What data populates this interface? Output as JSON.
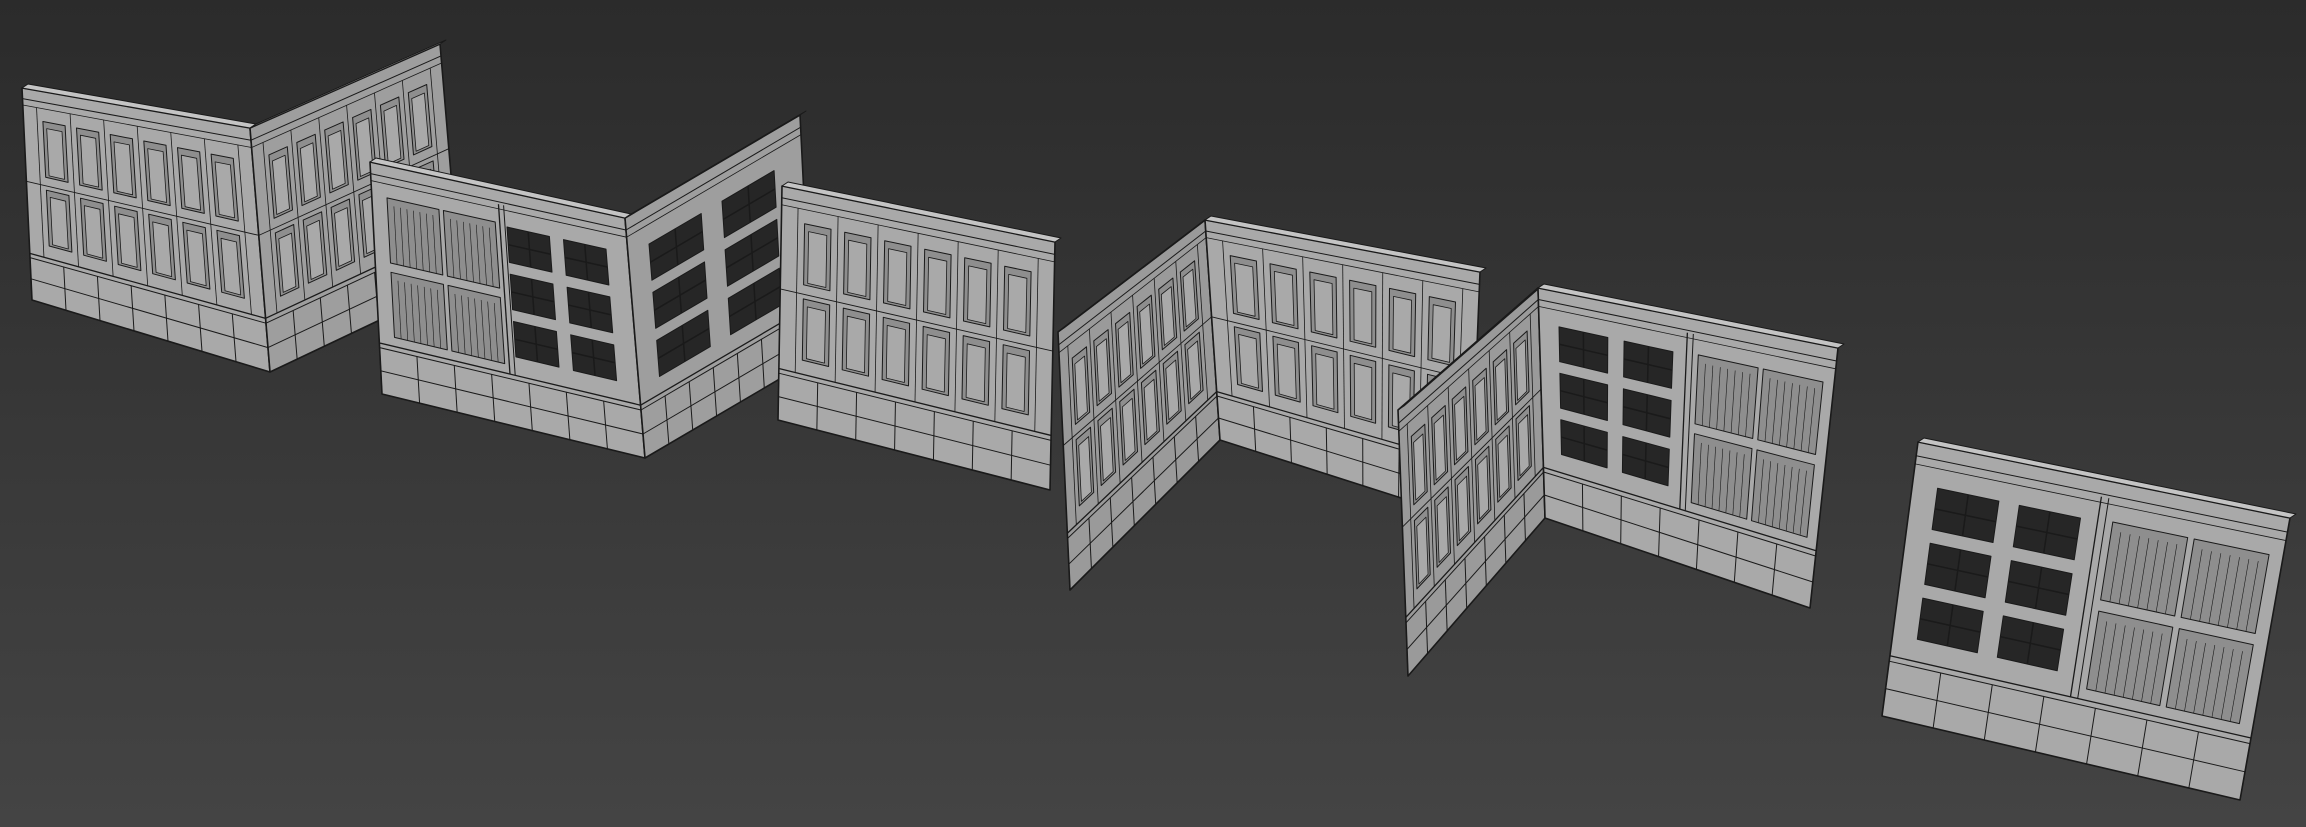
{
  "scene": {
    "background_top": "#2b2b2b",
    "background_bottom": "#444444",
    "wall_fill": "#a9a9a9",
    "wall_fill_dark": "#8e8e8e",
    "wire_color": "#1a1a1a",
    "window_glass": "#262626",
    "modules": [
      {
        "kind": "corner-wall",
        "left_style": "arches",
        "right_style": "arches"
      },
      {
        "kind": "corner-wall",
        "left_style": "panels-grid",
        "right_style": "grid-windows"
      },
      {
        "kind": "flat-wall",
        "style": "arches"
      },
      {
        "kind": "inner-corner-wall",
        "left_style": "arches",
        "right_style": "arches"
      },
      {
        "kind": "inner-corner-wall",
        "left_style": "arches",
        "right_style": "grid-panels"
      },
      {
        "kind": "flat-wall",
        "style": "grid-panels"
      }
    ]
  }
}
